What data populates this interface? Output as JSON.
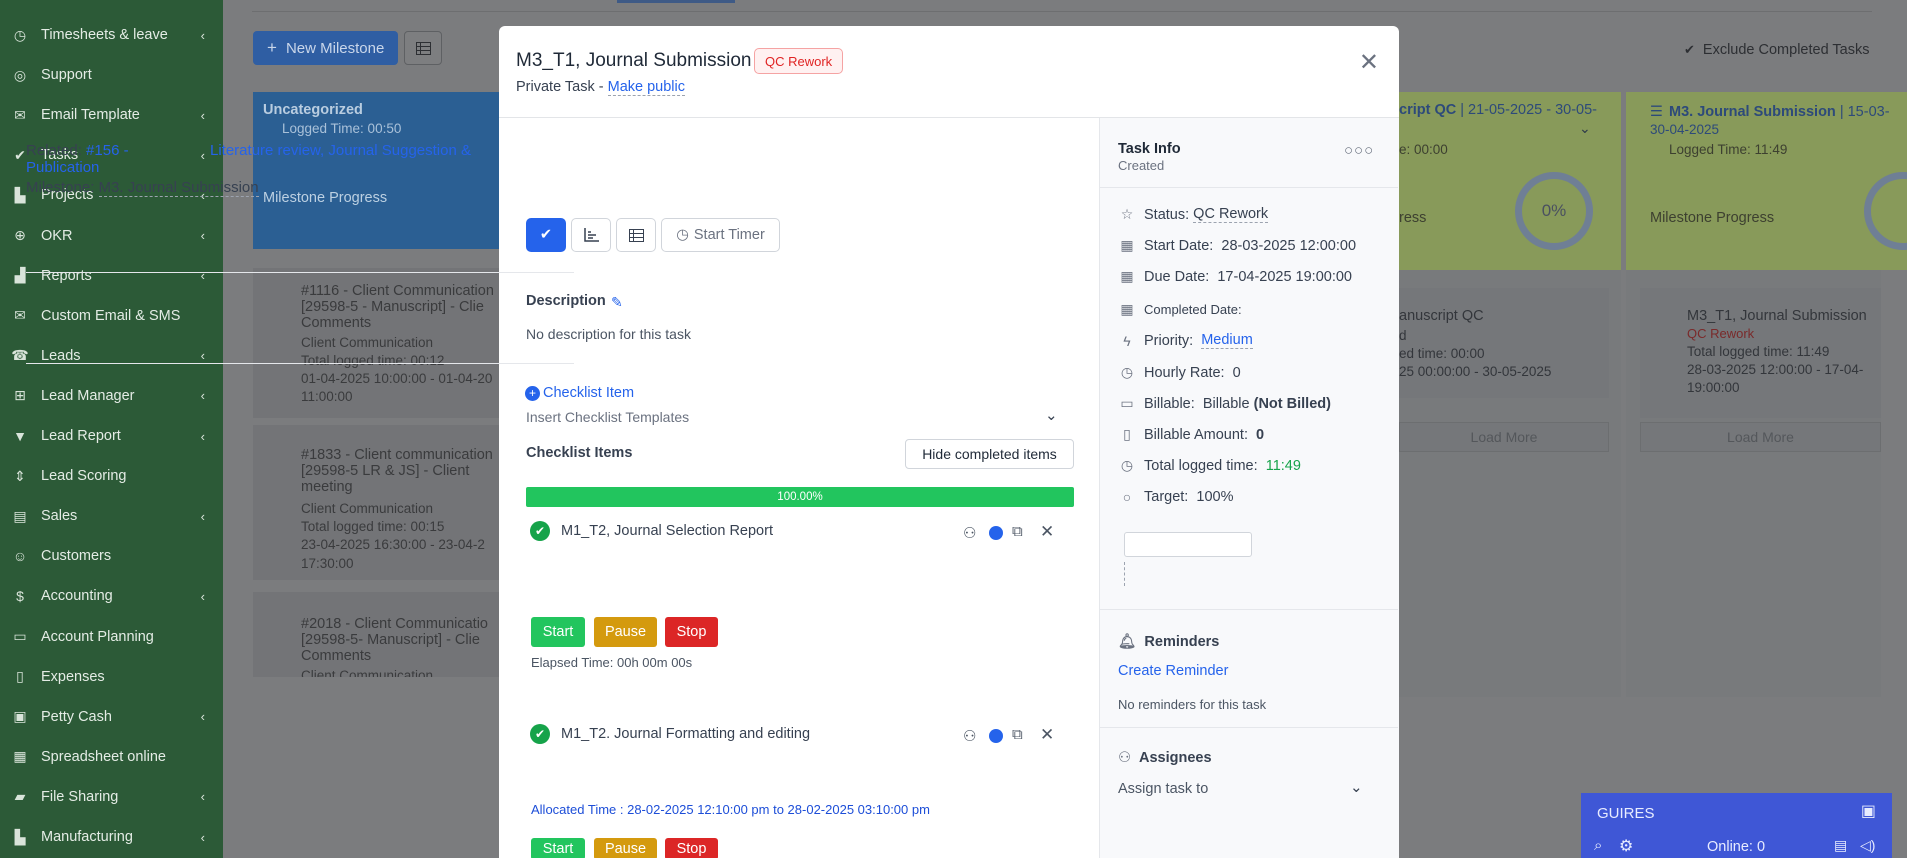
{
  "sidebar": {
    "items": [
      {
        "label": "Timesheets & leave",
        "icon": "clock-icon",
        "chevron": true
      },
      {
        "label": "Support",
        "icon": "lifebuoy-icon",
        "chevron": false
      },
      {
        "label": "Email Template",
        "icon": "envelope-icon",
        "chevron": true
      },
      {
        "label": "Tasks",
        "icon": "check-circle-icon",
        "chevron": true
      },
      {
        "label": "Projects",
        "icon": "chart-bars-icon",
        "chevron": true
      },
      {
        "label": "OKR",
        "icon": "crosshair-icon",
        "chevron": true
      },
      {
        "label": "Reports",
        "icon": "chart-area-icon",
        "chevron": true
      },
      {
        "label": "Custom Email & SMS",
        "icon": "envelope-icon",
        "chevron": false
      },
      {
        "label": "Leads",
        "icon": "tty-icon",
        "chevron": true
      },
      {
        "label": "Lead Manager",
        "icon": "sitemap-icon",
        "chevron": true
      },
      {
        "label": "Lead Report",
        "icon": "filter-icon",
        "chevron": true
      },
      {
        "label": "Lead Scoring",
        "icon": "sort-icon",
        "chevron": false
      },
      {
        "label": "Sales",
        "icon": "receipt-icon",
        "chevron": true
      },
      {
        "label": "Customers",
        "icon": "user-icon",
        "chevron": false
      },
      {
        "label": "Accounting",
        "icon": "dollar-icon",
        "chevron": true
      },
      {
        "label": "Account Planning",
        "icon": "id-card-icon",
        "chevron": false
      },
      {
        "label": "Expenses",
        "icon": "file-icon",
        "chevron": false
      },
      {
        "label": "Petty Cash",
        "icon": "wallet-icon",
        "chevron": true
      },
      {
        "label": "Spreadsheet online",
        "icon": "file-sheet-icon",
        "chevron": false
      },
      {
        "label": "File Sharing",
        "icon": "folder-icon",
        "chevron": true
      },
      {
        "label": "Manufacturing",
        "icon": "industry-icon",
        "chevron": true
      }
    ]
  },
  "board": {
    "new_milestone_label": "New Milestone",
    "exclude_completed_label": "Exclude Completed Tasks",
    "uncategorized": {
      "title": "Uncategorized",
      "logged": "Logged Time: 00:50",
      "progress_label": "Milestone Progress"
    },
    "cards_left": [
      {
        "title": "#1116 - Client Communication",
        "line2": "[29598-5 - Manuscript] - Clie",
        "line3": "Comments",
        "type": "Client Communication",
        "logged": "Total logged time: 00:12",
        "dates": "01-04-2025 10:00:00 - 01-04-20",
        "dates2": "11:00:00"
      },
      {
        "title": "#1833 - Client communication",
        "line2": "[29598-5 LR & JS] - Client",
        "line3": "meeting",
        "type": "Client Communication",
        "logged": "Total logged time: 00:15",
        "dates": "23-04-2025 16:30:00 - 23-04-2",
        "dates2": "17:30:00"
      },
      {
        "title": "#2018 - Client Communicatio",
        "line2": "[29598-5- Manuscript] - Clie",
        "line3": "Comments",
        "type": "Client Communication",
        "logged": "",
        "dates": "",
        "dates2": ""
      }
    ],
    "col_qc": {
      "title_partial": "cript QC",
      "dates_partial": "| 21-05-2025 - 30-05-",
      "logged_partial": "e: 00:00",
      "progress_partial": "ress",
      "percent": "0%",
      "card_title": "anuscript QC",
      "card_l2": "d",
      "card_l3": "ed time: 00:00",
      "card_l4": "25 00:00:00 - 30-05-2025",
      "load_more": "Load More"
    },
    "col_js": {
      "title": "M3. Journal Submission",
      "dates_partial": "| 15-03-",
      "dates2": "30-04-2025",
      "logged": "Logged Time: 11:49",
      "progress_label": "Milestone Progress",
      "card_title": "M3_T1, Journal Submission",
      "card_status": "QC Rework",
      "card_logged": "Total logged time: 11:49",
      "card_dates": "28-03-2025 12:00:00 - 17-04-",
      "card_dates2": "19:00:00",
      "load_more": "Load More"
    }
  },
  "modal": {
    "title": "M3_T1, Journal Submission",
    "status_badge": "QC Rework",
    "private_label": "Private Task -",
    "make_public": "Make public",
    "related_label": "Related:",
    "related_link_1": "#156 -",
    "related_link_2": "Publication",
    "related_link_3": "Literature review, Journal Suggestion &",
    "milestone_label": "Milestone:",
    "milestone_value": "M3. Journal Submission",
    "start_timer": "Start Timer",
    "description_label": "Description",
    "description_text": "No description for this task",
    "checklist_item_label": "Checklist Item",
    "insert_templates": "Insert Checklist Templates",
    "checklist_items_label": "Checklist Items",
    "hide_completed": "Hide completed items",
    "progress_text": "100.00%",
    "progress_value": 1.0,
    "items": [
      {
        "text": "M1_T2, Journal Selection  Report",
        "elapsed": "Elapsed Time: 00h 00m 00s"
      },
      {
        "text": "M1_T2. Journal Formatting and editing",
        "allocated": "Allocated Time : 28-02-2025 12:10:00 pm to 28-02-2025 03:10:00 pm"
      }
    ],
    "btn_start": "Start",
    "btn_pause": "Pause",
    "btn_stop": "Stop"
  },
  "task_info": {
    "title": "Task Info",
    "created": "Created",
    "status_label": "Status:",
    "status_value": "QC Rework",
    "start_label": "Start Date:",
    "start_value": "28-03-2025 12:00:00",
    "due_label": "Due Date:",
    "due_value": "17-04-2025 19:00:00",
    "completed_label": "Completed Date:",
    "priority_label": "Priority:",
    "priority_value": "Medium",
    "hourly_label": "Hourly Rate:",
    "hourly_value": "0",
    "billable_label": "Billable:",
    "billable_value": "Billable",
    "billable_note": "(Not Billed)",
    "billable_amount_label": "Billable Amount:",
    "billable_amount_value": "0",
    "total_logged_label": "Total logged time:",
    "total_logged_value": "11:49",
    "target_label": "Target:",
    "target_value": "100%",
    "reminders_title": "Reminders",
    "create_reminder": "Create Reminder",
    "no_reminders": "No reminders for this task",
    "assignees_title": "Assignees",
    "assign_to": "Assign task to"
  },
  "chat": {
    "title": "GUIRES",
    "online": "Online: 0"
  },
  "colors": {
    "sidebar": "#2c5a37",
    "primary": "#2563eb",
    "success": "#22c55e",
    "warning": "#d49a0e",
    "danger": "#dc2626",
    "chat": "#3f57d6"
  }
}
